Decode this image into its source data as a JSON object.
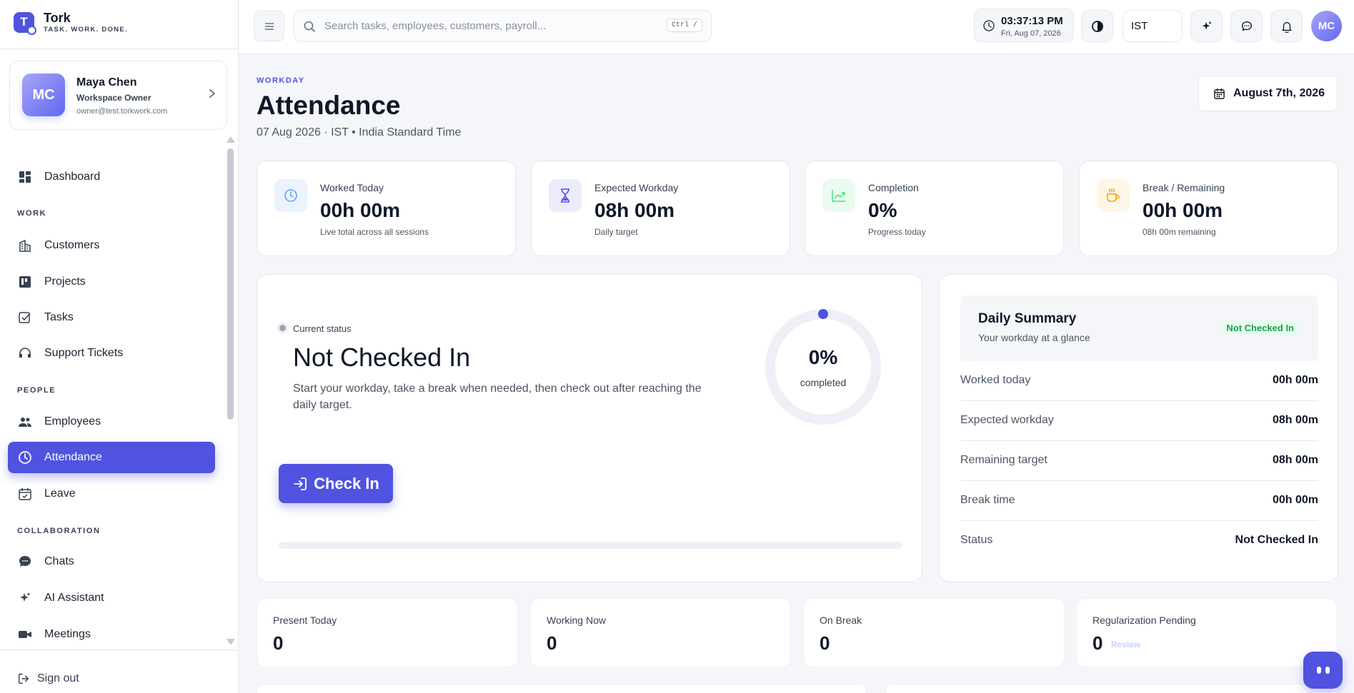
{
  "brand": {
    "name": "Tork",
    "tagline": "TASK. WORK. DONE.",
    "logo_letter": "T"
  },
  "user": {
    "initials": "MC",
    "name": "Maya Chen",
    "role": "Workspace Owner",
    "email": "owner@test.torkwork.com"
  },
  "nav": {
    "dashboard": "Dashboard",
    "section_work": "WORK",
    "customers": "Customers",
    "projects": "Projects",
    "tasks": "Tasks",
    "support_tickets": "Support Tickets",
    "section_people": "PEOPLE",
    "employees": "Employees",
    "attendance": "Attendance",
    "leave": "Leave",
    "section_collab": "COLLABORATION",
    "chats": "Chats",
    "ai_assistant": "AI Assistant",
    "meetings": "Meetings",
    "sign_out": "Sign out"
  },
  "topbar": {
    "search_placeholder": "Search tasks, employees, customers, payroll...",
    "search_shortcut": "Ctrl /",
    "time": "03:37:13 PM",
    "date": "Fri, Aug 07, 2026",
    "timezone": "IST",
    "avatar_initials": "MC"
  },
  "page": {
    "eyebrow": "WORKDAY",
    "title": "Attendance",
    "subtitle": "07 Aug 2026 · IST • India Standard Time",
    "date_button": "August 7th, 2026"
  },
  "stats": [
    {
      "label": "Worked Today",
      "value": "00h 00m",
      "note": "Live total across all sessions",
      "icon": "clock-icon",
      "color": "#3b82f6"
    },
    {
      "label": "Expected Workday",
      "value": "08h 00m",
      "note": "Daily target",
      "icon": "hourglass-icon",
      "color": "#4f53e0"
    },
    {
      "label": "Completion",
      "value": "0%",
      "note": "Progress today",
      "icon": "trend-icon",
      "color": "#22c55e"
    },
    {
      "label": "Break / Remaining",
      "value": "00h 00m",
      "note": "08h 00m remaining",
      "icon": "coffee-icon",
      "color": "#f59e0b"
    }
  ],
  "status": {
    "kicker": "Current status",
    "title": "Not Checked In",
    "description": "Start your workday, take a break when needed, then check out after reaching the daily target.",
    "ring_value": "0%",
    "ring_label": "completed",
    "completion_fraction": 0,
    "button": "Check In"
  },
  "summary": {
    "title": "Daily Summary",
    "subtitle": "Your workday at a glance",
    "badge": "Not Checked In",
    "rows": [
      {
        "key": "Worked today",
        "value": "00h 00m"
      },
      {
        "key": "Expected workday",
        "value": "08h 00m"
      },
      {
        "key": "Remaining target",
        "value": "08h 00m"
      },
      {
        "key": "Break time",
        "value": "00h 00m"
      },
      {
        "key": "Status",
        "value": "Not Checked In"
      }
    ]
  },
  "team": [
    {
      "label": "Present Today",
      "value": "0"
    },
    {
      "label": "Working Now",
      "value": "0"
    },
    {
      "label": "On Break",
      "value": "0"
    },
    {
      "label": "Regularization Pending",
      "value": "0",
      "extra": "Review"
    }
  ],
  "colors": {
    "accent": "#4f53e0",
    "success": "#16a34a"
  }
}
